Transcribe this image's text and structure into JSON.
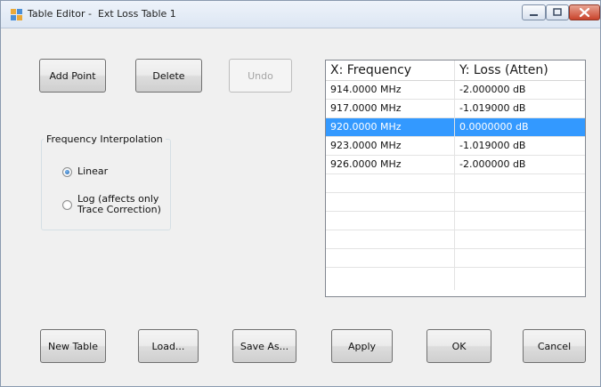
{
  "window": {
    "title": "Table Editor -  Ext Loss Table 1"
  },
  "toolbar": {
    "add_point": "Add Point",
    "delete": "Delete",
    "undo": "Undo"
  },
  "interpolation": {
    "group_label": "Frequency Interpolation",
    "options": [
      {
        "label": "Linear",
        "selected": true
      },
      {
        "label": "Log (affects only\nTrace Correction)",
        "selected": false
      }
    ]
  },
  "table": {
    "headers": [
      "X: Frequency",
      "Y: Loss (Atten)"
    ],
    "rows": [
      {
        "x": "914.0000 MHz",
        "y": "-2.000000 dB",
        "selected": false
      },
      {
        "x": "917.0000 MHz",
        "y": "-1.019000 dB",
        "selected": false
      },
      {
        "x": "920.0000 MHz",
        "y": "0.0000000 dB",
        "selected": true
      },
      {
        "x": "923.0000 MHz",
        "y": "-1.019000 dB",
        "selected": false
      },
      {
        "x": "926.0000 MHz",
        "y": "-2.000000 dB",
        "selected": false
      }
    ]
  },
  "footer": {
    "new_table": "New Table",
    "load": "Load...",
    "save_as": "Save As...",
    "apply": "Apply",
    "ok": "OK",
    "cancel": "Cancel"
  },
  "colors": {
    "selection": "#3399ff",
    "window_bg": "#f0f0f0",
    "close_button": "#c9432b"
  }
}
